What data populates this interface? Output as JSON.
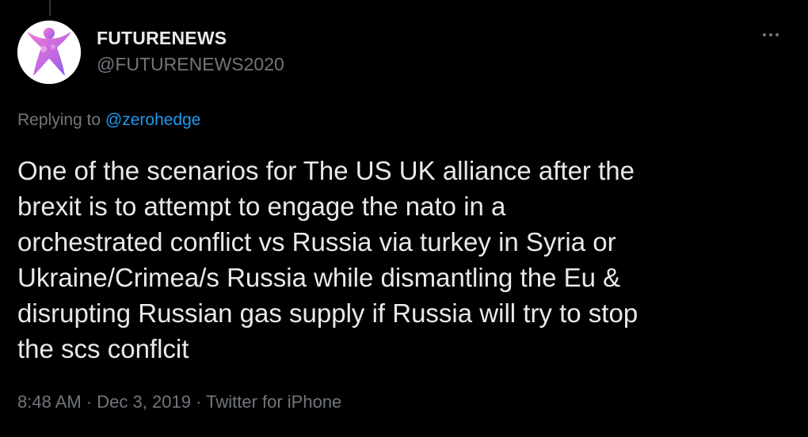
{
  "author": {
    "display_name": "FUTURENEWS",
    "handle": "@FUTURENEWS2020"
  },
  "reply": {
    "prefix": "Replying to ",
    "mention": "@zerohedge"
  },
  "tweet": {
    "text": "One of the scenarios for The US UK alliance after the\nbrexit is to attempt to engage the nato in a\norchestrated conflict vs Russia via turkey in Syria or\nUkraine/Crimea/s Russia  while dismantling the Eu &\ndisrupting Russian gas supply if Russia will try to stop\nthe scs conflcit"
  },
  "meta": {
    "time": "8:48 AM",
    "separator": "·",
    "date": "Dec 3, 2019",
    "source": "Twitter for iPhone"
  },
  "icons": {
    "more": "more-options-icon"
  },
  "colors": {
    "background": "#000000",
    "primary_text": "#e7e9ea",
    "secondary_text": "#71767b",
    "link": "#1d9bf0"
  }
}
